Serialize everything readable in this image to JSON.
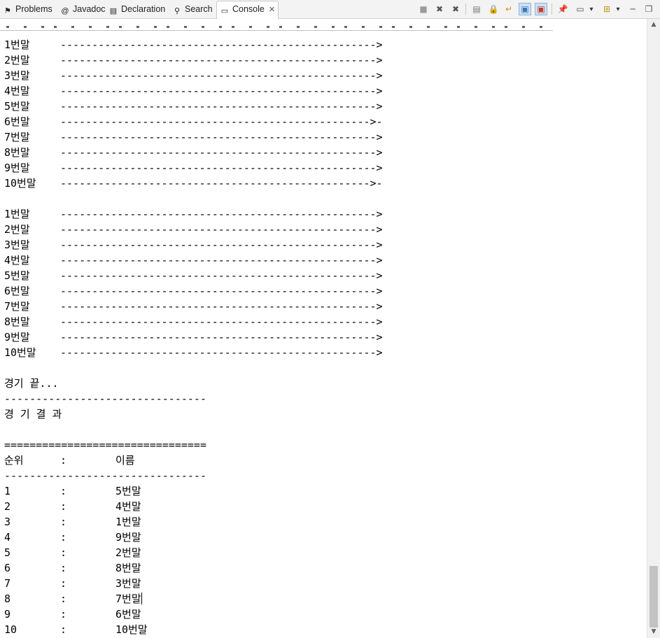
{
  "tabs": [
    {
      "label": "Problems",
      "icon": "problems-icon",
      "glyph": "⚑"
    },
    {
      "label": "Javadoc",
      "icon": "javadoc-icon",
      "glyph": "@"
    },
    {
      "label": "Declaration",
      "icon": "declaration-icon",
      "glyph": "▤"
    },
    {
      "label": "Search",
      "icon": "search-icon",
      "glyph": "⚲"
    },
    {
      "label": "Console",
      "icon": "console-icon",
      "glyph": "▭",
      "active": true
    }
  ],
  "toolbar": [
    {
      "name": "terminate-icon",
      "glyph": "■"
    },
    {
      "name": "remove-launch-icon",
      "glyph": "✖"
    },
    {
      "name": "remove-all-terminated-icon",
      "glyph": "✖"
    },
    {
      "name": "clear-console-icon",
      "glyph": "▤"
    },
    {
      "name": "scroll-lock-icon",
      "glyph": "🔒"
    },
    {
      "name": "word-wrap-icon",
      "glyph": "↵"
    },
    {
      "name": "show-on-stdout-icon",
      "glyph": "▣"
    },
    {
      "name": "show-on-stderr-icon",
      "glyph": "▣"
    },
    {
      "name": "pin-console-icon",
      "glyph": "📌"
    },
    {
      "name": "display-console-icon",
      "glyph": "▭"
    },
    {
      "name": "display-console-dropdown-icon",
      "glyph": "▾"
    },
    {
      "name": "open-console-icon",
      "glyph": "⊞"
    },
    {
      "name": "open-console-dropdown-icon",
      "glyph": "▾"
    },
    {
      "name": "minimize-icon",
      "glyph": "─"
    },
    {
      "name": "maximize-icon",
      "glyph": "❐"
    }
  ],
  "console": {
    "race1": [
      {
        "horse": "1번말",
        "track": "-------------------------------------------------->"
      },
      {
        "horse": "2번말",
        "track": "-------------------------------------------------->"
      },
      {
        "horse": "3번말",
        "track": "-------------------------------------------------->"
      },
      {
        "horse": "4번말",
        "track": "-------------------------------------------------->"
      },
      {
        "horse": "5번말",
        "track": "-------------------------------------------------->"
      },
      {
        "horse": "6번말",
        "track": "------------------------------------------------->-"
      },
      {
        "horse": "7번말",
        "track": "-------------------------------------------------->"
      },
      {
        "horse": "8번말",
        "track": "-------------------------------------------------->"
      },
      {
        "horse": "9번말",
        "track": "-------------------------------------------------->"
      },
      {
        "horse": "10번말",
        "track": "------------------------------------------------->-"
      }
    ],
    "race2": [
      {
        "horse": "1번말",
        "track": "-------------------------------------------------->"
      },
      {
        "horse": "2번말",
        "track": "-------------------------------------------------->"
      },
      {
        "horse": "3번말",
        "track": "-------------------------------------------------->"
      },
      {
        "horse": "4번말",
        "track": "-------------------------------------------------->"
      },
      {
        "horse": "5번말",
        "track": "-------------------------------------------------->"
      },
      {
        "horse": "6번말",
        "track": "-------------------------------------------------->"
      },
      {
        "horse": "7번말",
        "track": "-------------------------------------------------->"
      },
      {
        "horse": "8번말",
        "track": "-------------------------------------------------->"
      },
      {
        "horse": "9번말",
        "track": "-------------------------------------------------->"
      },
      {
        "horse": "10번말",
        "track": "-------------------------------------------------->"
      }
    ],
    "game_over": "경기 끝...",
    "dash_line": "--------------------------------",
    "result_title": "경 기 결 과",
    "equals_line": "================================",
    "header": {
      "rank": "순위",
      "sep": ":",
      "name": "이름"
    },
    "results": [
      {
        "rank": "1",
        "sep": ":",
        "name": "5번말"
      },
      {
        "rank": "2",
        "sep": ":",
        "name": "4번말"
      },
      {
        "rank": "3",
        "sep": ":",
        "name": "1번말"
      },
      {
        "rank": "4",
        "sep": ":",
        "name": "9번말"
      },
      {
        "rank": "5",
        "sep": ":",
        "name": "2번말"
      },
      {
        "rank": "6",
        "sep": ":",
        "name": "8번말"
      },
      {
        "rank": "7",
        "sep": ":",
        "name": "3번말"
      },
      {
        "rank": "8",
        "sep": ":",
        "name": "7번말"
      },
      {
        "rank": "9",
        "sep": ":",
        "name": "6번말"
      },
      {
        "rank": "10",
        "sep": ":",
        "name": "10번말"
      }
    ]
  }
}
